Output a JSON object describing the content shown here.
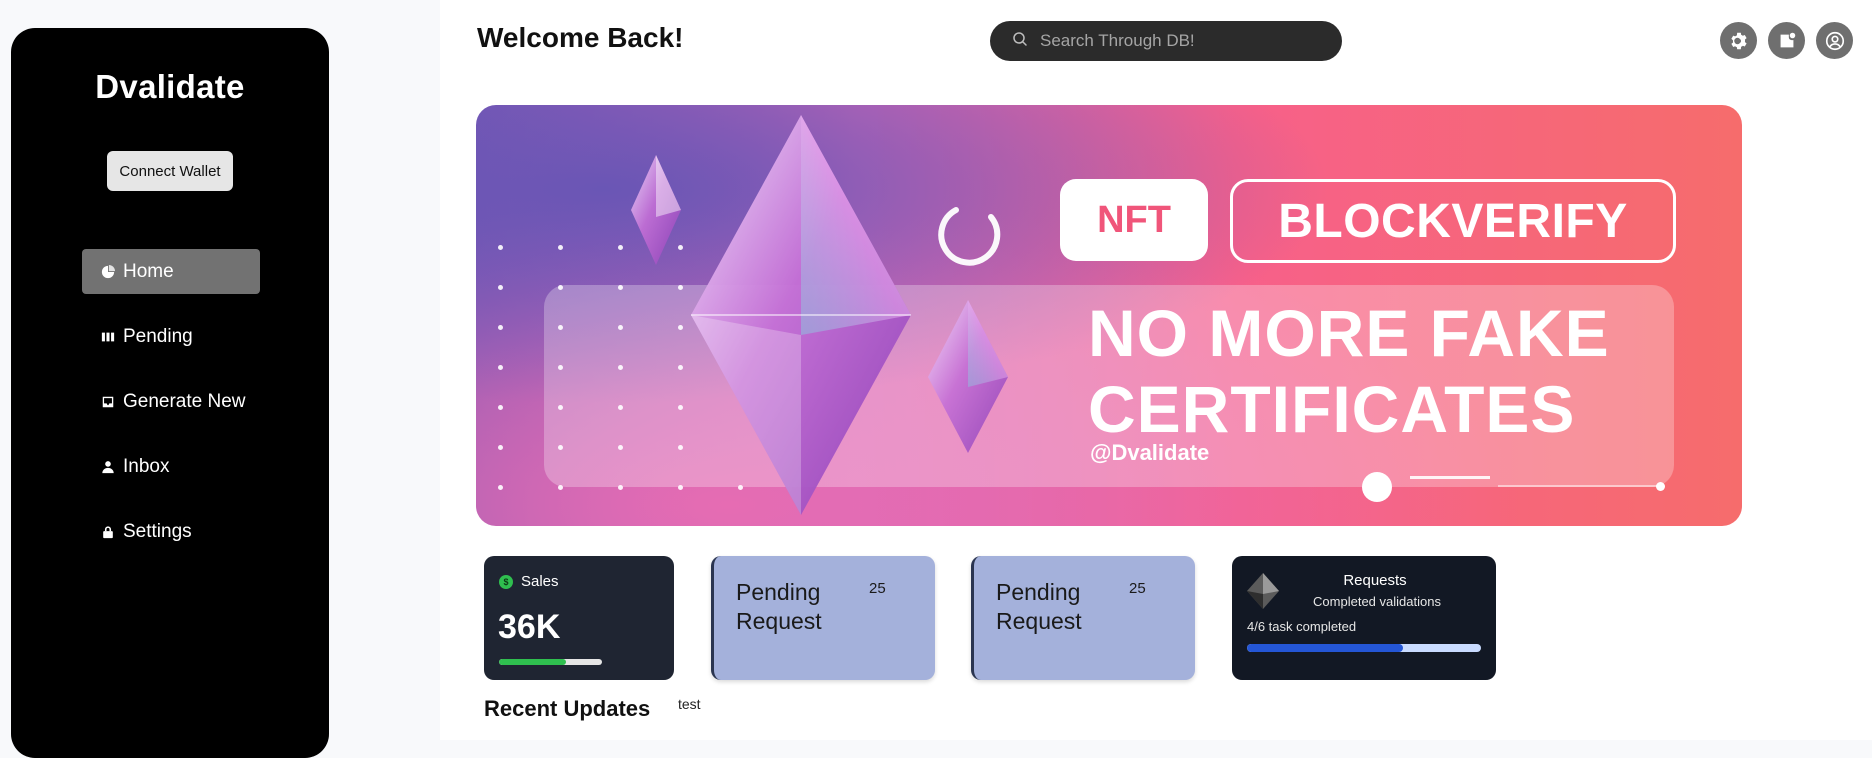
{
  "app": {
    "brand": "Dvalidate"
  },
  "sidebar": {
    "connect_wallet": "Connect Wallet",
    "items": [
      {
        "label": "Home",
        "icon": "pie-chart-icon",
        "active": true
      },
      {
        "label": "Pending",
        "icon": "columns-icon",
        "active": false
      },
      {
        "label": "Generate New",
        "icon": "inbox-tray-icon",
        "active": false
      },
      {
        "label": "Inbox",
        "icon": "user-icon",
        "active": false
      },
      {
        "label": "Settings",
        "icon": "lock-icon",
        "active": false
      }
    ]
  },
  "header": {
    "welcome": "Welcome Back!",
    "search_placeholder": "Search Through DB!",
    "icons": [
      "gear-icon",
      "notification-icon",
      "user-circle-icon"
    ]
  },
  "banner": {
    "badge": "NFT",
    "tag": "BLOCKVERIFY",
    "headline_line1": "NO MORE FAKE",
    "headline_line2": "CERTIFICATES",
    "handle": "@Dvalidate"
  },
  "cards": {
    "sales": {
      "label": "Sales",
      "value": "36K",
      "progress": 0.65,
      "accent": "#2fbf4f"
    },
    "pending": [
      {
        "title": "Pending Request",
        "count": "25"
      },
      {
        "title": "Pending Request",
        "count": "25"
      }
    ],
    "requests": {
      "title": "Requests",
      "subtitle": "Completed validations",
      "progress_text": "4/6 task completed",
      "progress": 0.667,
      "accent": "#2456d6"
    }
  },
  "recent": {
    "title": "Recent Updates",
    "note": "test"
  }
}
